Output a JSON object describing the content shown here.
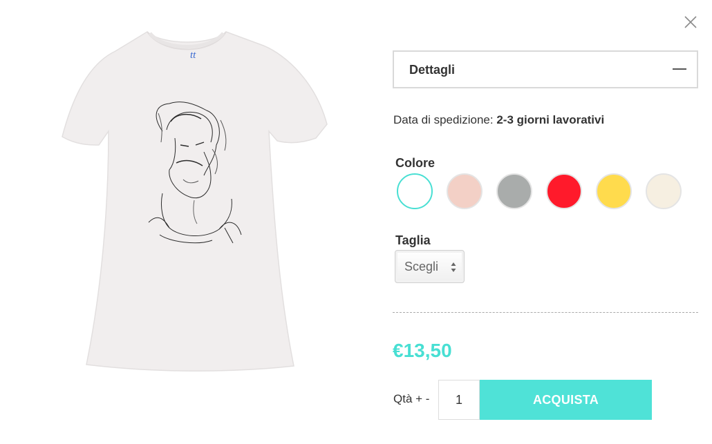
{
  "icons": {
    "close": "close-icon",
    "collapse": "minus-icon",
    "select_arrows": "updown-arrows-icon",
    "brand_logo": "brand-logo-icon"
  },
  "details": {
    "label": "Dettagli"
  },
  "shipping": {
    "label": "Data di spedizione:",
    "value": "2-3 giorni lavorativi"
  },
  "color": {
    "label": "Colore",
    "selected_index": 0,
    "options": [
      {
        "name": "bianco",
        "hex": "#ffffff"
      },
      {
        "name": "rosa",
        "hex": "#f3d0c6"
      },
      {
        "name": "grigio",
        "hex": "#a9acab"
      },
      {
        "name": "rosso",
        "hex": "#ff1a2b"
      },
      {
        "name": "giallo",
        "hex": "#ffdb4d"
      },
      {
        "name": "crema",
        "hex": "#f6efe1"
      }
    ],
    "accent": "#48dfd3"
  },
  "size": {
    "label": "Taglia",
    "selected": "Scegli"
  },
  "price": {
    "value": "€13,50",
    "color": "#48dfd3"
  },
  "quantity": {
    "label": "Qtà + -",
    "value": "1"
  },
  "buy": {
    "label": "ACQUISTA",
    "color": "#4fe2d7"
  },
  "product": {
    "shirt_color": "#f1eeee"
  }
}
